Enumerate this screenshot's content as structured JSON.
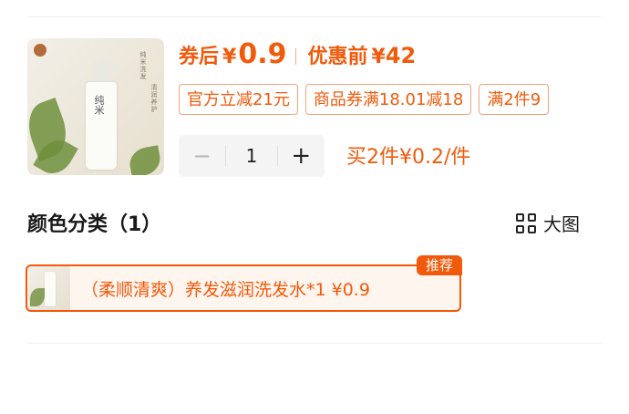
{
  "product": {
    "thumbnail_text": "纯米",
    "thumbnail_side_text": "纯米洗发",
    "thumbnail_side_text2": "清润养护",
    "after_coupon_label": "券后",
    "currency": "¥",
    "after_coupon_price": "0.9",
    "before_discount_label": "优惠前",
    "before_discount_price": "42"
  },
  "coupons": [
    {
      "label": "官方立减21元"
    },
    {
      "label": "商品券满18.01减18"
    },
    {
      "label": "满2件9"
    }
  ],
  "quantity": {
    "minus": "−",
    "value": "1",
    "plus": "+"
  },
  "multi_buy": "买2件¥0.2/件",
  "color_section": {
    "title": "颜色分类（1）",
    "view_label": "大图"
  },
  "options": [
    {
      "text": "（柔顺清爽）养发滋润洗发水*1  ¥0.9",
      "badge": "推荐"
    }
  ],
  "colors": {
    "accent": "#f15a0b",
    "accent_border": "#f3a37a",
    "option_bg": "#fff5ef"
  }
}
